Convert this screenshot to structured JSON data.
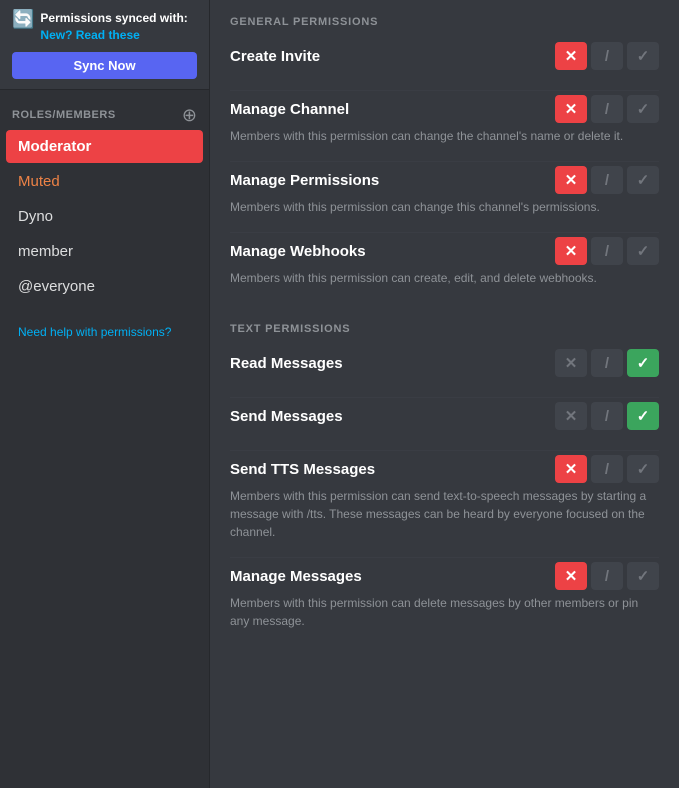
{
  "sidebar": {
    "sync_banner": {
      "icon": "🔄",
      "text": "Permissions synced with: ",
      "link_text": "New? Read these",
      "sync_button": "Sync Now"
    },
    "roles_header": "ROLES/MEMBERS",
    "add_icon": "⊕",
    "roles": [
      {
        "id": "moderator",
        "label": "Moderator",
        "state": "active"
      },
      {
        "id": "muted",
        "label": "Muted",
        "state": "muted"
      },
      {
        "id": "dyno",
        "label": "Dyno",
        "state": "normal"
      },
      {
        "id": "member",
        "label": "member",
        "state": "normal"
      },
      {
        "id": "everyone",
        "label": "@everyone",
        "state": "normal"
      }
    ],
    "help_link": "Need help with permissions?"
  },
  "main": {
    "general_section_title": "GENERAL PERMISSIONS",
    "text_section_title": "TEXT PERMISSIONS",
    "permissions": [
      {
        "id": "create-invite",
        "name": "Create Invite",
        "desc": "",
        "deny": "active",
        "neutral": "inactive",
        "allow": "inactive"
      },
      {
        "id": "manage-channel",
        "name": "Manage Channel",
        "desc": "Members with this permission can change the channel's name or delete it.",
        "deny": "active",
        "neutral": "inactive",
        "allow": "inactive"
      },
      {
        "id": "manage-permissions",
        "name": "Manage Permissions",
        "desc": "Members with this permission can change this channel's permissions.",
        "deny": "active",
        "neutral": "inactive",
        "allow": "inactive"
      },
      {
        "id": "manage-webhooks",
        "name": "Manage Webhooks",
        "desc": "Members with this permission can create, edit, and delete webhooks.",
        "deny": "active",
        "neutral": "inactive",
        "allow": "inactive"
      }
    ],
    "text_permissions": [
      {
        "id": "read-messages",
        "name": "Read Messages",
        "desc": "",
        "deny": "inactive",
        "neutral": "inactive",
        "allow": "active"
      },
      {
        "id": "send-messages",
        "name": "Send Messages",
        "desc": "",
        "deny": "inactive",
        "neutral": "inactive",
        "allow": "active"
      },
      {
        "id": "send-tts-messages",
        "name": "Send TTS Messages",
        "desc": "Members with this permission can send text-to-speech messages by starting a message with /tts. These messages can be heard by everyone focused on the channel.",
        "deny": "active",
        "neutral": "inactive",
        "allow": "inactive"
      },
      {
        "id": "manage-messages",
        "name": "Manage Messages",
        "desc": "Members with this permission can delete messages by other members or pin any message.",
        "deny": "active",
        "neutral": "inactive",
        "allow": "inactive"
      }
    ]
  }
}
